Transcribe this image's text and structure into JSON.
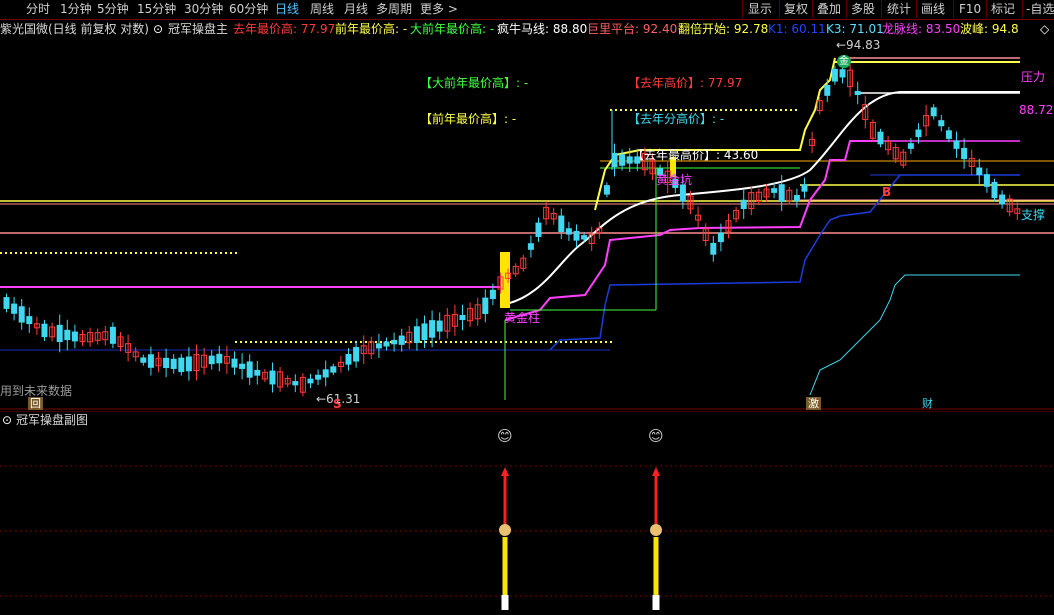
{
  "toolbar": {
    "left_items": [
      "分时",
      "1分钟",
      "5分钟",
      "15分钟",
      "30分钟",
      "60分钟",
      "日线",
      "周线",
      "月线",
      "多周期",
      "更多 >"
    ],
    "active_index": 6,
    "right_items": [
      "显示",
      "复权",
      "叠加",
      "多股",
      "统计",
      "画线",
      "F10",
      "标记",
      "-自选"
    ]
  },
  "info_bar": {
    "stock": "紫光国微(日线 前复权 对数)",
    "indicator": "冠军操盘主",
    "items": [
      {
        "text": "去年最价高: 77.97",
        "color": "#ff3b3b"
      },
      {
        "text": "前年最价高: -",
        "color": "#ffff4a"
      },
      {
        "text": "大前年最价高: -",
        "color": "#40ff40"
      },
      {
        "text": "疯牛马线: 88.80",
        "color": "#ffffff"
      },
      {
        "text": "巨里平台: 92.40",
        "color": "#ff6060"
      },
      {
        "text": "翻倍开始: 92.78",
        "color": "#ffff4a"
      },
      {
        "text": "K1: 60.11",
        "color": "#2244ff"
      },
      {
        "text": "K3: 71.01",
        "color": "#5ae0ff"
      },
      {
        "text": "龙脉线: 83.50",
        "color": "#ff40ff"
      },
      {
        "text": "波峰: 94.8",
        "color": "#ffff4a"
      }
    ]
  },
  "chart_labels": {
    "big_prev_year_high": "【大前年最价高】: -",
    "prev_year_high": "【前年最价高】: -",
    "last_year_high": "【去年高价】: 77.97",
    "last_year_split_high": "【去年分高价】: -",
    "last_year_high_price": "【去年最高价】: 43.60",
    "golden_pillar": "黄金柱",
    "golden_pit": "黄金坑",
    "pressure": "压力",
    "support": "支撑",
    "price_88": "88.72",
    "low_price": "←61.31",
    "high_price": "←94.83",
    "future_data": "用到未来数据",
    "mark_b": "B",
    "mark_s": "S",
    "mark_hui": "回",
    "mark_ji": "激",
    "mark_cai": "财",
    "mark_gold": "金"
  },
  "sub_panel": {
    "title": "冠军操盘副图"
  },
  "colors": {
    "up": "#ff3b3b",
    "down": "#40d8f0",
    "bg": "#000000",
    "grid_red": "#7a0000",
    "magenta": "#ff40ff",
    "white": "#ffffff",
    "yellow": "#ffff4a",
    "blue": "#1a2dbb",
    "cyan": "#40d8f0",
    "pink": "#ff8c8c"
  }
}
